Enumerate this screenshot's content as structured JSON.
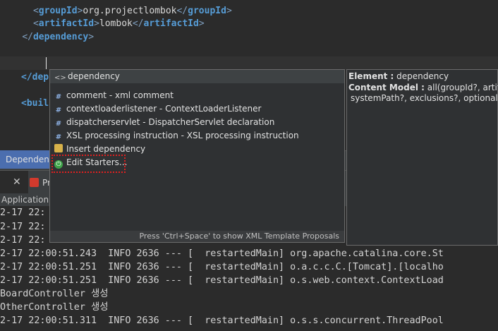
{
  "editor": {
    "lines": [
      {
        "indent": "      ",
        "open": "groupId",
        "text": "org.projectlombok",
        "close": "groupId"
      },
      {
        "indent": "      ",
        "open": "artifactId",
        "text": "lombok",
        "close": "artifactId"
      },
      {
        "indent": "    ",
        "closing": "dependency"
      }
    ],
    "partial_close": "</dep",
    "partial_open": "<buil"
  },
  "tabs": {
    "dependencies": "Dependenc",
    "close_glyph": "✕",
    "pr_label": "Pr",
    "app_title": "Application ["
  },
  "content_assist": {
    "header": "dependency",
    "items": [
      {
        "icon": "xml-comment-icon",
        "label": "comment - xml comment"
      },
      {
        "icon": "template-icon",
        "label": "contextloaderlistener - ContextLoaderListener"
      },
      {
        "icon": "template-icon",
        "label": "dispatcherservlet - DispatcherServlet declaration"
      },
      {
        "icon": "template-icon",
        "label": "XSL processing instruction - XSL processing instruction"
      },
      {
        "icon": "folder-icon",
        "label": "Insert dependency"
      },
      {
        "icon": "power-icon",
        "label": "Edit Starters..."
      }
    ],
    "footer": "Press 'Ctrl+Space' to show XML Template Proposals"
  },
  "info_popup": {
    "element_label": "Element :",
    "element_value": " dependency",
    "content_label": "Content Model :",
    "content_value": " all(groupId?, artifactId",
    "content_value2": "systemPath?, exclusions?, optional?)"
  },
  "console": {
    "lines": [
      "2-17 22:00:51.243  INFO 2636 --- [  restartedMain] org.apache.catalina.core.St",
      "2-17 22:00:51.251  INFO 2636 --- [  restartedMain] o.a.c.c.C.[Tomcat].[localho",
      "2-17 22:00:51.251  INFO 2636 --- [  restartedMain] o.s.web.context.ContextLoad",
      "BoardController 생성",
      "OtherController 생성",
      "2-17 22:00:51.311  INFO 2636 --- [  restartedMain] o.s.s.concurrent.ThreadPool"
    ],
    "hidden_prefix": "2-17 22:"
  }
}
